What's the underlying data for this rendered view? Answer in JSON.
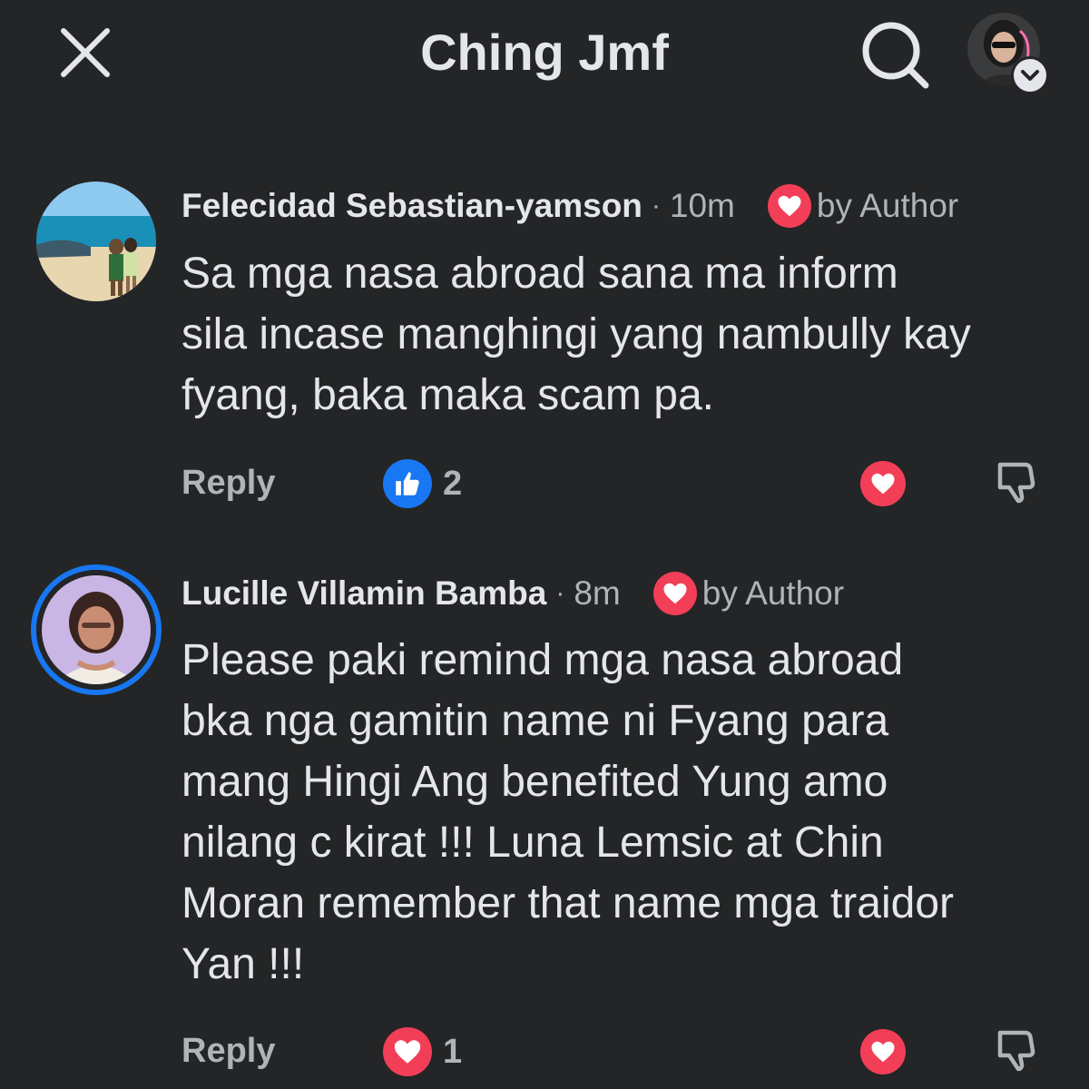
{
  "header": {
    "title": "Ching Jmf",
    "close_icon": "close-icon",
    "search_icon": "search-icon"
  },
  "comments": [
    {
      "author": "Felecidad Sebastian-yamson",
      "separator": "·",
      "time": "10m",
      "author_badge": "by Author",
      "text_lines": [
        "Sa mga nasa abroad sana ma inform",
        "sila incase manghingi yang nambully kay",
        "fyang, baka maka scam pa."
      ],
      "reply_label": "Reply",
      "reaction_type": "like",
      "reaction_count": "2"
    },
    {
      "author": "Lucille Villamin Bamba",
      "separator": "·",
      "time": "8m",
      "author_badge": "by Author",
      "text_lines": [
        "Please paki remind mga nasa abroad",
        "bka nga gamitin name ni Fyang para",
        "mang Hingi Ang benefited Yung amo",
        "nilang c kirat !!! Luna Lemsic at Chin",
        "Moran remember that name mga traidor",
        "Yan !!!"
      ],
      "reply_label": "Reply",
      "reaction_type": "love",
      "reaction_count": "1"
    }
  ],
  "colors": {
    "background": "#242526",
    "text_primary": "#e4e6eb",
    "text_secondary": "#b0b3b8",
    "like_blue": "#1877f2",
    "love_red": "#f33e58"
  }
}
